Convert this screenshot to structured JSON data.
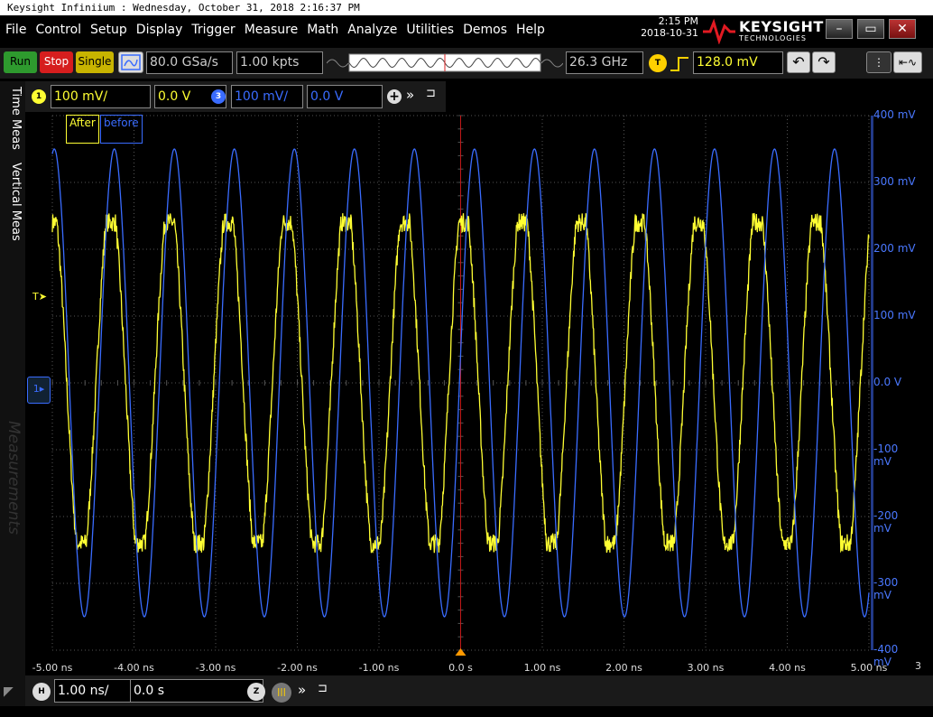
{
  "window_title": "Keysight Infiniium : Wednesday, October 31, 2018 2:16:37 PM",
  "menu": [
    "File",
    "Control",
    "Setup",
    "Display",
    "Trigger",
    "Measure",
    "Math",
    "Analyze",
    "Utilities",
    "Demos",
    "Help"
  ],
  "clock": {
    "time": "2:15 PM",
    "date": "2018-10-31"
  },
  "logo": {
    "brand": "KEYSIGHT",
    "sub": "TECHNOLOGIES"
  },
  "toolbar": {
    "run": "Run",
    "stop": "Stop",
    "single": "Single",
    "sample_rate": "80.0 GSa/s",
    "memory_depth": "1.00 kpts",
    "bandwidth": "26.3 GHz",
    "trigger_badge": "T",
    "trigger_level": "128.0 mV"
  },
  "channels": [
    {
      "badge": "1",
      "scale": "100 mV/",
      "offset": "0.0 V",
      "color": "#ffff33"
    },
    {
      "badge": "3",
      "scale": "100 mV/",
      "offset": "0.0 V",
      "color": "#3a6cff"
    }
  ],
  "side_tabs": [
    "Time Meas",
    "Vertical Meas",
    "Measurements"
  ],
  "legend": {
    "ch1": "After",
    "ch3": "before"
  },
  "markers": {
    "trigger": "T",
    "ground": "1"
  },
  "timebase": {
    "badge": "H",
    "scale": "1.00 ns/",
    "position": "0.0 s",
    "zoom_badge": "Z"
  },
  "colors": {
    "ch1": "#ffff33",
    "ch3": "#3a6cff",
    "trigger_marker": "#ff9900",
    "grid": "#555555"
  },
  "chart_data": {
    "type": "line",
    "xlabel": "",
    "ylabel": "",
    "x_ticks": [
      "-5.00 ns",
      "-4.00 ns",
      "-3.00 ns",
      "-2.00 ns",
      "-1.00 ns",
      "0.0 s",
      "1.00 ns",
      "2.00 ns",
      "3.00 ns",
      "4.00 ns",
      "5.00 ns"
    ],
    "y_ticks": [
      "400 mV",
      "300 mV",
      "200 mV",
      "100 mV",
      "0.0 V",
      "-100 mV",
      "-200 mV",
      "-300 mV",
      "-400 mV"
    ],
    "xlim_ns": [
      -5,
      5
    ],
    "ylim_mV": [
      -400,
      400
    ],
    "grid": true,
    "series": [
      {
        "name": "After",
        "color": "#ffff33",
        "amplitude_mV": 240,
        "period_ns": 0.72,
        "phase_cycles": 0.2,
        "noise": true
      },
      {
        "name": "before",
        "color": "#3a6cff",
        "amplitude_mV": 350,
        "period_ns": 0.735,
        "phase_cycles": 0.02,
        "noise": false
      }
    ]
  }
}
